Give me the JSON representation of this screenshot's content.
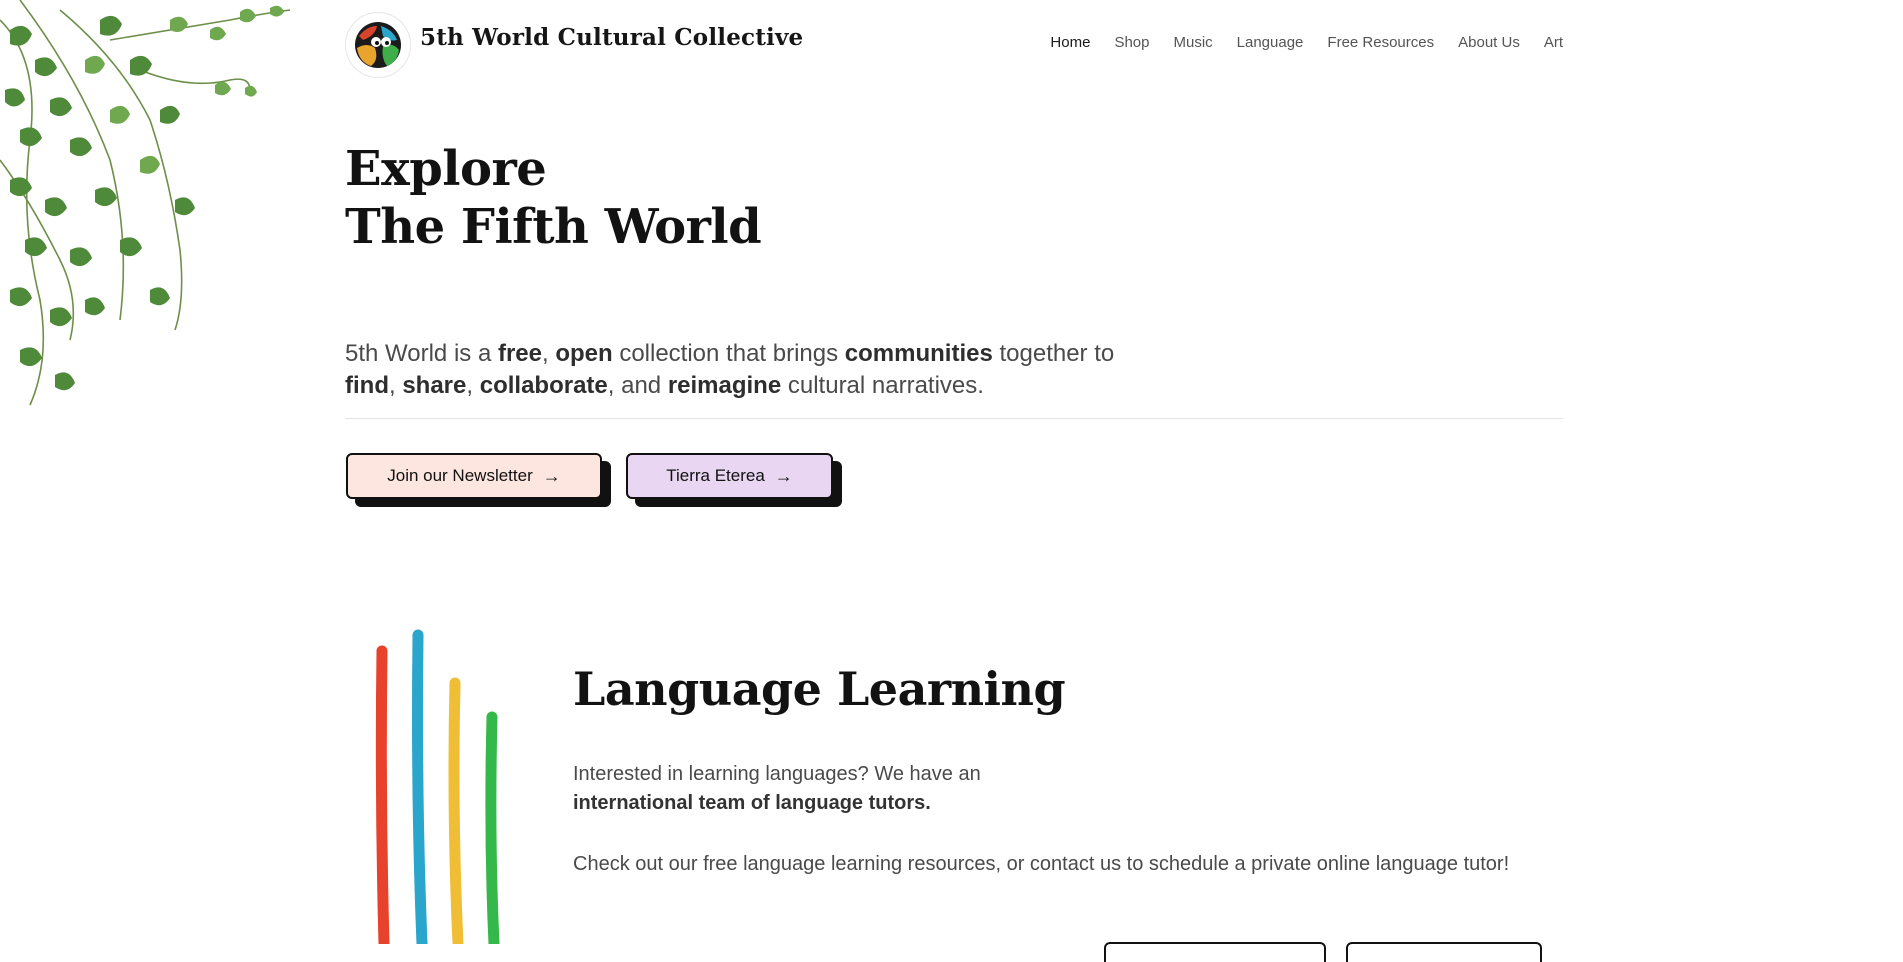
{
  "header": {
    "brand": "5th World Cultural Collective",
    "nav": [
      "Home",
      "Shop",
      "Music",
      "Language",
      "Free Resources",
      "About Us",
      "Art"
    ],
    "active_nav": "Home"
  },
  "hero": {
    "title_line1": "Explore",
    "title_line2": "The Fifth World",
    "text": {
      "t1": "5th World is a ",
      "b1": "free",
      "t2": ", ",
      "b2": "open",
      "t3": " collection that brings ",
      "b3": "communities",
      "t4": " together to ",
      "b4": "find",
      "t5": ", ",
      "b5": "share",
      "t6": ", ",
      "b6": "collaborate",
      "t7": ", and ",
      "b7": "reimagine",
      "t8": " cultural narratives."
    },
    "buttons": {
      "newsletter": "Join our Newsletter",
      "tierra": "Tierra Eterea",
      "arrow": "→"
    }
  },
  "language_section": {
    "title": "Language Learning",
    "p1_text": "Interested in learning languages? We have an",
    "p1_bold": "international team of language tutors.",
    "p2": "Check out our free language learning resources, or contact us to schedule a private online language tutor!"
  },
  "colors": {
    "newsletter_bg": "#fde6e0",
    "tierra_bg": "#e8d6f2",
    "stripe_red": "#e8412c",
    "stripe_blue": "#2aa6cc",
    "stripe_yellow": "#f0be35",
    "stripe_green": "#35b84a"
  }
}
